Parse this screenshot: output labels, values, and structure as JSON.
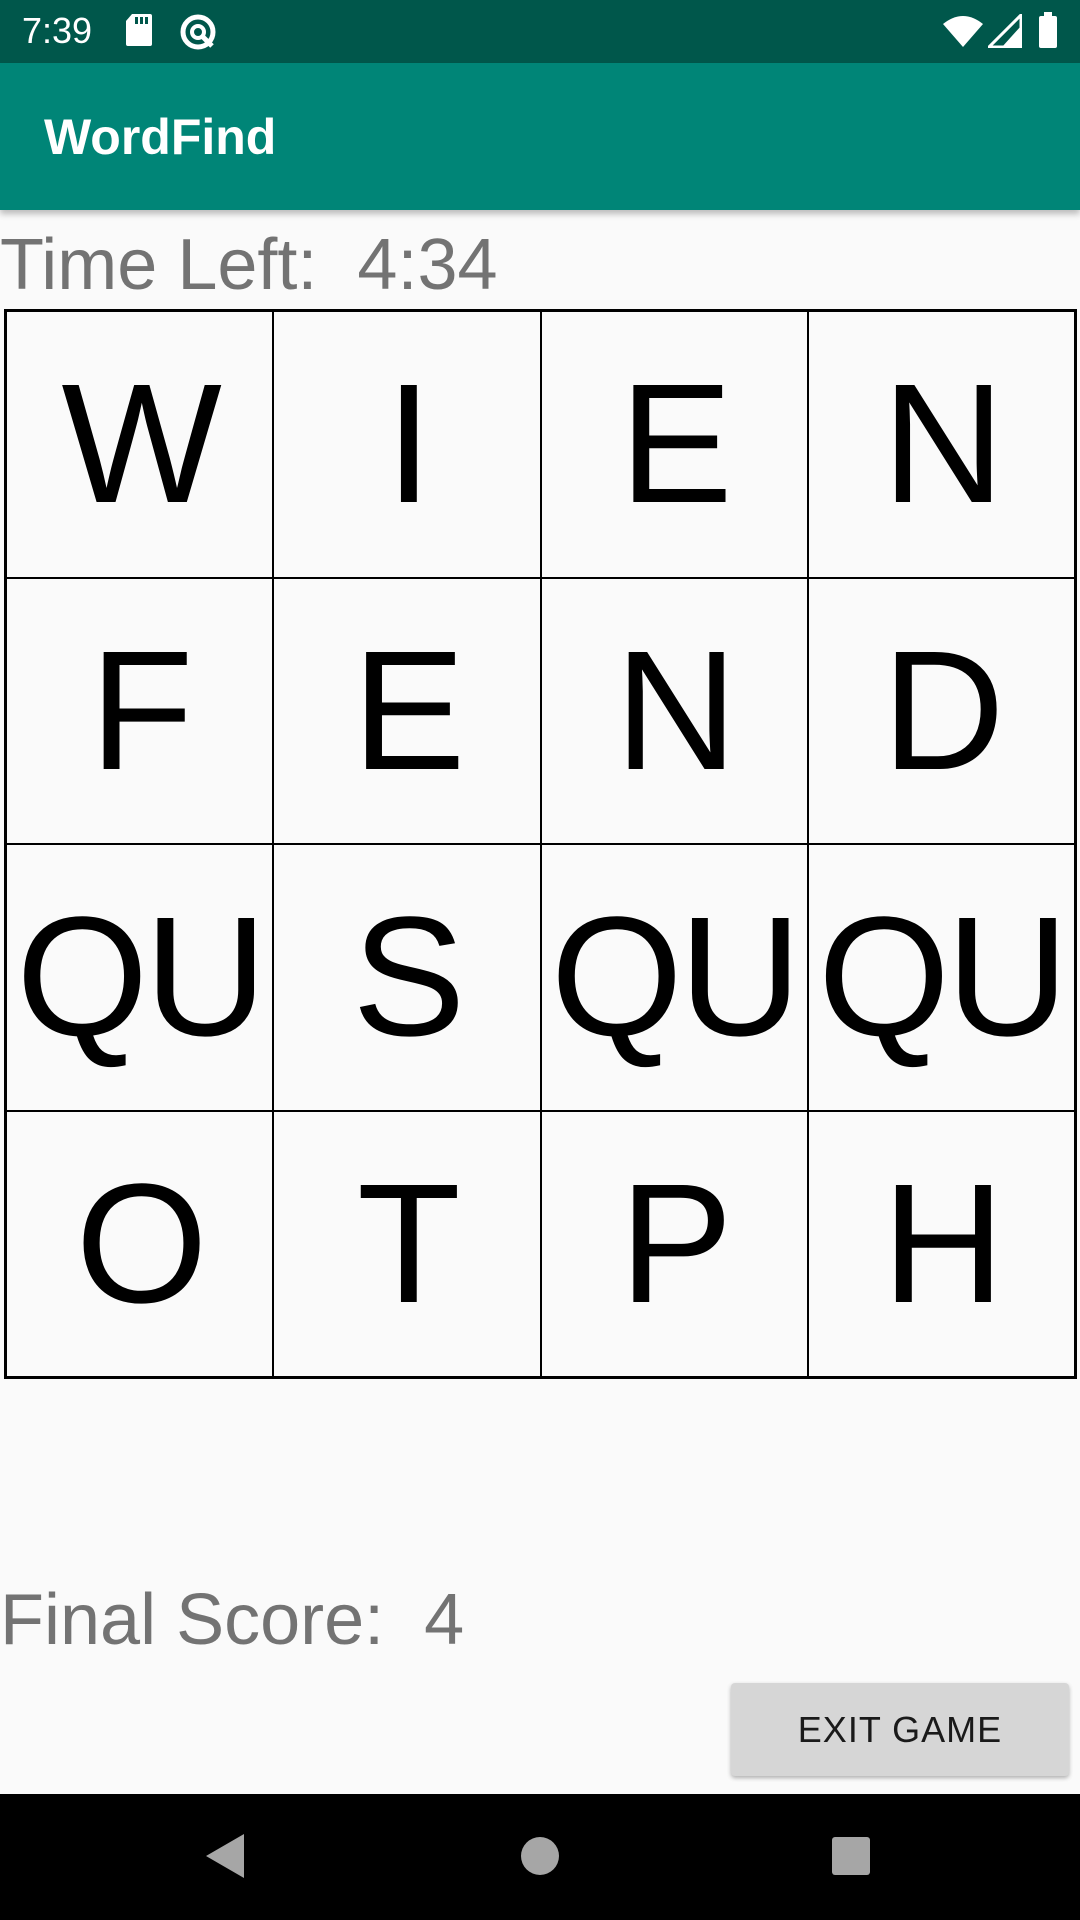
{
  "status_bar": {
    "time": "7:39",
    "left_icons": [
      "sd-card-icon",
      "sync-icon"
    ],
    "right_icons": [
      "wifi-icon",
      "cell-signal-icon",
      "battery-icon"
    ]
  },
  "app_bar": {
    "title": "WordFind",
    "color": "#008577"
  },
  "timer": {
    "label": "Time Left:",
    "value": "4:34",
    "text": "Time Left:  4:34"
  },
  "board": {
    "rows": [
      [
        "W",
        "I",
        "E",
        "N"
      ],
      [
        "F",
        "E",
        "N",
        "D"
      ],
      [
        "QU",
        "S",
        "QU",
        "QU"
      ],
      [
        "O",
        "T",
        "P",
        "H"
      ]
    ]
  },
  "score": {
    "label": "Final Score:",
    "value": "4",
    "text": "Final Score:  4"
  },
  "exit_button": {
    "label": "EXIT GAME"
  },
  "nav_bar": {
    "buttons": [
      "back-icon",
      "home-icon",
      "recents-icon"
    ]
  }
}
